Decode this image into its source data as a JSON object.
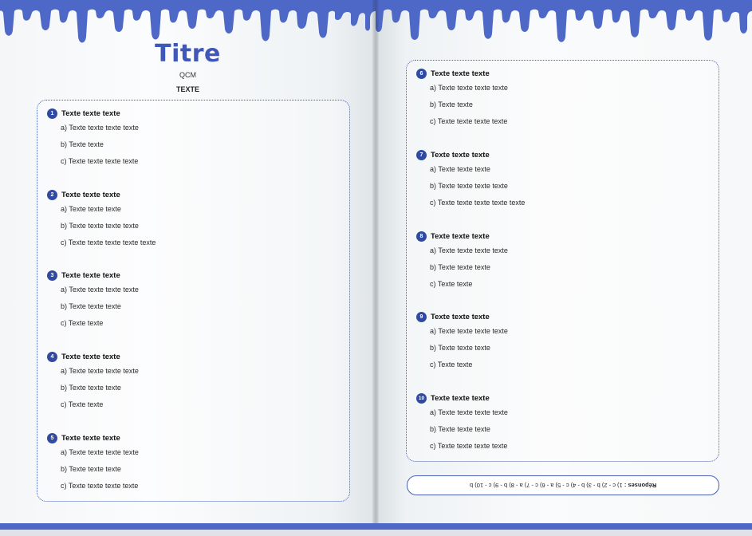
{
  "header": {
    "title": "Titre",
    "subtitle": "QCM",
    "subtitle2": "TEXTE"
  },
  "colors": {
    "accent": "#3f57b8",
    "badge": "#2f4aa0",
    "drip": "#4e68c7",
    "border": "#4a5fb5"
  },
  "questions": [
    {
      "num": "1",
      "title": "Texte texte texte",
      "options": [
        "a) Texte texte texte texte",
        "b) Texte texte",
        "c) Texte texte texte texte"
      ]
    },
    {
      "num": "2",
      "title": "Texte texte texte",
      "options": [
        "a) Texte texte texte",
        "b) Texte texte texte texte",
        "c) Texte texte texte texte texte"
      ]
    },
    {
      "num": "3",
      "title": "Texte texte texte",
      "options": [
        "a) Texte texte texte texte",
        "b) Texte texte texte",
        "c) Texte texte"
      ]
    },
    {
      "num": "4",
      "title": "Texte texte texte",
      "options": [
        "a) Texte texte texte texte",
        "b) Texte texte texte",
        "c) Texte texte"
      ]
    },
    {
      "num": "5",
      "title": "Texte texte texte",
      "options": [
        "a) Texte texte texte texte",
        "b) Texte texte texte",
        "c) Texte texte texte texte"
      ]
    },
    {
      "num": "6",
      "title": "Texte texte texte",
      "options": [
        "a) Texte texte texte texte",
        "b) Texte texte",
        "c) Texte texte texte texte"
      ]
    },
    {
      "num": "7",
      "title": "Texte texte texte",
      "options": [
        "a) Texte texte texte",
        "b) Texte texte texte texte",
        "c) Texte texte texte texte texte"
      ]
    },
    {
      "num": "8",
      "title": "Texte texte texte",
      "options": [
        "a) Texte texte texte texte",
        "b) Texte texte texte",
        "c) Texte texte"
      ]
    },
    {
      "num": "9",
      "title": "Texte texte texte",
      "options": [
        "a) Texte texte texte texte",
        "b) Texte texte texte",
        "c) Texte texte"
      ]
    },
    {
      "num": "10",
      "title": "Texte texte texte",
      "options": [
        "a) Texte texte texte texte",
        "b) Texte texte texte",
        "c) Texte texte texte texte"
      ]
    }
  ],
  "answers": {
    "label": "Réponses :",
    "text": "1) c - 2) b - 3) b - 4) c - 5) a - 6) c - 7) a - 8) b - 9) c - 10) b"
  }
}
